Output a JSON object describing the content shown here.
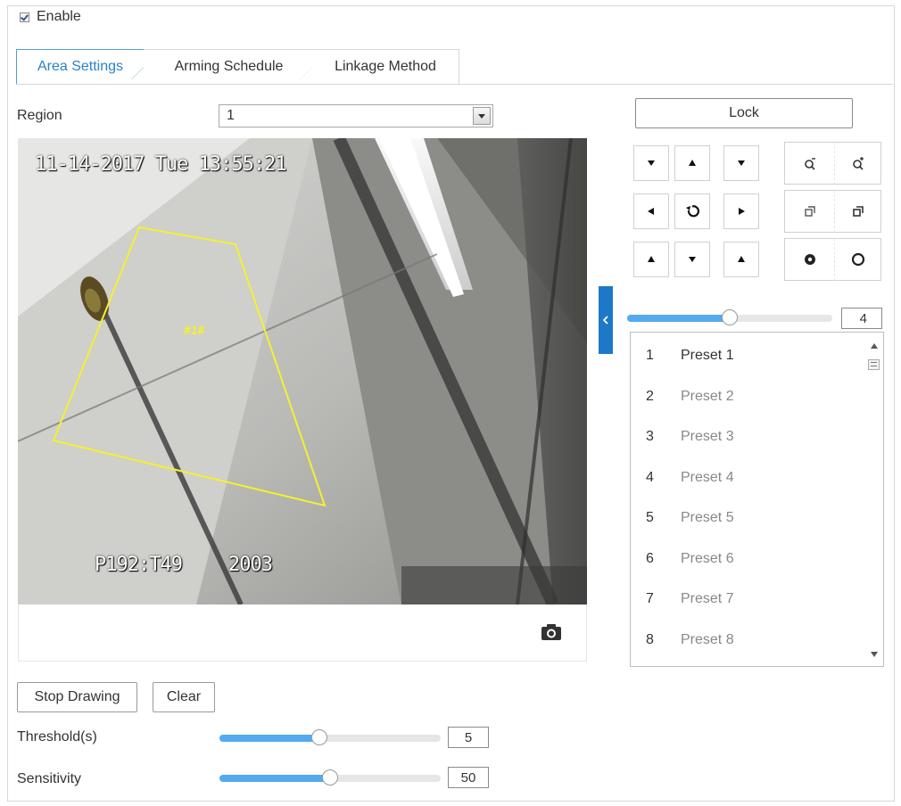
{
  "enable": {
    "label": "Enable",
    "checked": true
  },
  "tabs": [
    {
      "label": "Area Settings",
      "active": true
    },
    {
      "label": "Arming Schedule",
      "active": false
    },
    {
      "label": "Linkage Method",
      "active": false
    }
  ],
  "region": {
    "label": "Region",
    "value": "1"
  },
  "video": {
    "timestamp": "11-14-2017 Tue 13:55:21",
    "ptz_position": "P192:T49",
    "zoom_code": "2003",
    "area_label": "#1#"
  },
  "buttons": {
    "stop_drawing": "Stop Drawing",
    "clear": "Clear"
  },
  "threshold": {
    "label": "Threshold(s)",
    "value": "5",
    "fraction": 0.45
  },
  "sensitivity": {
    "label": "Sensitivity",
    "value": "50",
    "fraction": 0.5
  },
  "ptz": {
    "lock_label": "Lock",
    "speed": {
      "value": "4",
      "fraction": 0.5
    },
    "controls": [
      "pan-up-left-icon",
      "pan-up-icon",
      "pan-up-right-icon",
      "zoom-out-icon",
      "zoom-in-icon",
      "pan-left-icon",
      "auto-rotate-icon",
      "pan-right-icon",
      "focus-near-icon",
      "focus-far-icon",
      "pan-down-left-icon",
      "pan-down-icon",
      "pan-down-right-icon",
      "iris-close-icon",
      "iris-open-icon"
    ]
  },
  "presets": [
    {
      "num": "1",
      "name": "Preset 1"
    },
    {
      "num": "2",
      "name": "Preset 2"
    },
    {
      "num": "3",
      "name": "Preset 3"
    },
    {
      "num": "4",
      "name": "Preset 4"
    },
    {
      "num": "5",
      "name": "Preset 5"
    },
    {
      "num": "6",
      "name": "Preset 6"
    },
    {
      "num": "7",
      "name": "Preset 7"
    },
    {
      "num": "8",
      "name": "Preset 8"
    }
  ],
  "colors": {
    "accent": "#2a82c8",
    "slider": "#53aaee",
    "drawing": "#f2f230"
  }
}
